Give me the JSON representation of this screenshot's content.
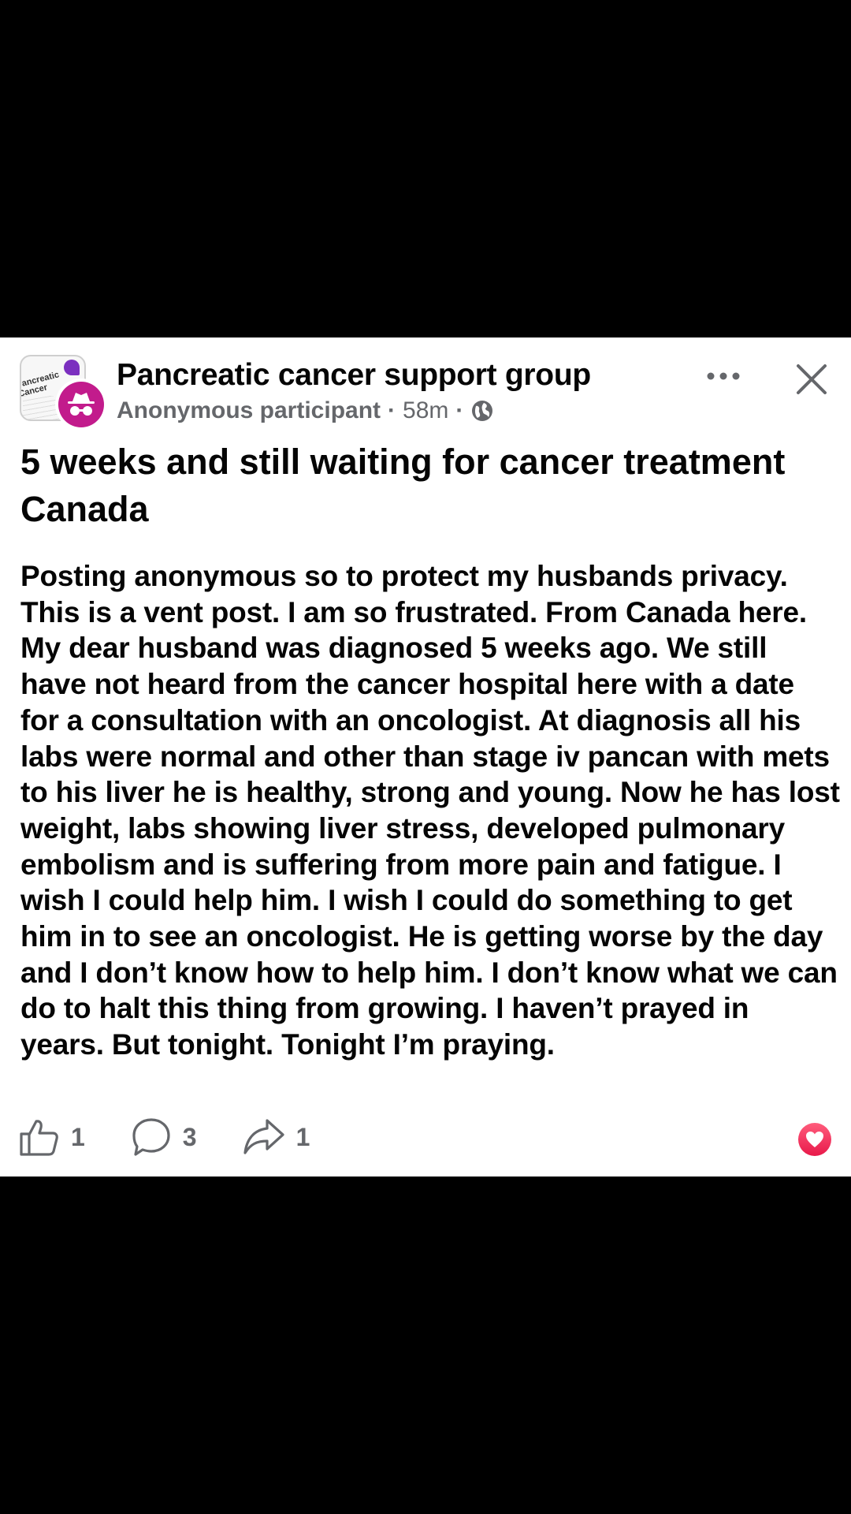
{
  "post": {
    "group_name": "Pancreatic cancer support group",
    "author": "Anonymous participant",
    "time": "58m",
    "separator": "·",
    "title": "5 weeks and still waiting for cancer treatment Canada",
    "body": "Posting anonymous so to protect my husbands privacy. This is a vent post. I am so frustrated. From Canada here. My dear husband was diagnosed 5 weeks ago. We still have not heard from the cancer hospital here with a date for a consultation with an oncologist. At diagnosis all his labs were normal and other than stage iv pancan with mets to his liver he is healthy, strong and young. Now he has lost weight, labs showing liver stress, developed pulmonary embolism and is suffering from more pain and fatigue. I wish I could help him. I wish I could do something to get him in to see an oncologist. He is getting worse by the day and I don’t know how to help him. I don’t know what we can do to halt this thing from growing. I haven’t prayed in years. But tonight. Tonight I’m praying.",
    "group_thumbnail_text": "Pancreatic Cancer"
  },
  "actions": {
    "like_count": "1",
    "comment_count": "3",
    "share_count": "1"
  },
  "icons": {
    "more": "more-horizontal-icon",
    "close": "close-icon",
    "audience": "globe-icon",
    "like": "thumbs-up-icon",
    "comment": "comment-bubble-icon",
    "share": "share-arrow-icon",
    "reaction": "heart-reaction-icon",
    "anonymous": "incognito-icon"
  },
  "colors": {
    "background": "#000000",
    "card": "#ffffff",
    "text_primary": "#050505",
    "text_secondary": "#65676b",
    "anon_avatar": "#c21b8c",
    "heart": "#e8194a"
  }
}
